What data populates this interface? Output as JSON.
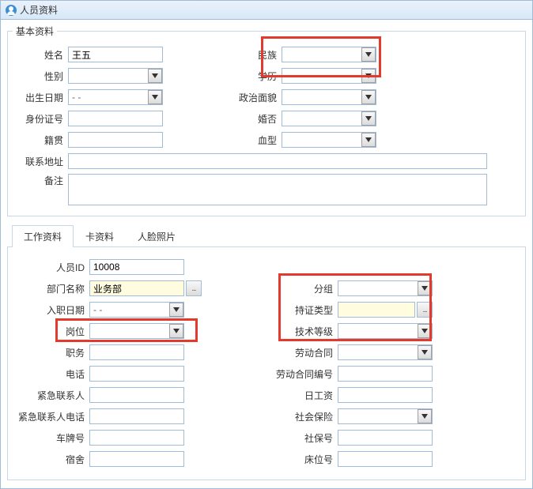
{
  "title": "人员资料",
  "basic": {
    "legend": "基本资料",
    "name_label": "姓名",
    "name_value": "王五",
    "nation_label": "民族",
    "gender_label": "性别",
    "education_label": "学历",
    "birth_label": "出生日期",
    "birth_value": "  -  -",
    "politics_label": "政治面貌",
    "idcard_label": "身份证号",
    "marriage_label": "婚否",
    "native_label": "籍贯",
    "blood_label": "血型",
    "address_label": "联系地址",
    "remark_label": "备注"
  },
  "tabs": {
    "work": "工作资料",
    "card": "卡资料",
    "face": "人脸照片"
  },
  "work": {
    "person_id_label": "人员ID",
    "person_id_value": "10008",
    "dept_label": "部门名称",
    "dept_value": "业务部",
    "group_label": "分组",
    "entry_date_label": "入职日期",
    "entry_date_value": "  -  -",
    "cert_type_label": "持证类型",
    "post_label": "岗位",
    "tech_level_label": "技术等级",
    "duty_label": "职务",
    "labor_contract_label": "劳动合同",
    "phone_label": "电话",
    "labor_contract_no_label": "劳动合同编号",
    "emergency_contact_label": "紧急联系人",
    "day_wage_label": "日工资",
    "emergency_phone_label": "紧急联系人电话",
    "social_insurance_label": "社会保险",
    "car_no_label": "车牌号",
    "social_no_label": "社保号",
    "dorm_label": "宿舍",
    "bed_label": "床位号"
  },
  "lookup_btn": "..."
}
